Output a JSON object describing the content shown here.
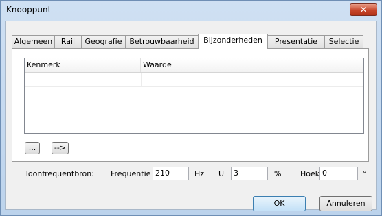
{
  "window": {
    "title": "Knooppunt",
    "close_glyph": "✕"
  },
  "tabs": [
    {
      "label": "Algemeen"
    },
    {
      "label": "Rail"
    },
    {
      "label": "Geografie"
    },
    {
      "label": "Betrouwbaarheid"
    },
    {
      "label": "Bijzonderheden",
      "active": true
    },
    {
      "label": "Presentatie"
    },
    {
      "label": "Selectie"
    }
  ],
  "grid": {
    "columns": [
      "Kenmerk",
      "Waarde"
    ],
    "rows": [
      [
        "",
        ""
      ]
    ]
  },
  "buttons": {
    "browse": "...",
    "arrow": "-->"
  },
  "source": {
    "label": "Toonfrequentbron:",
    "frequency_label": "Frequentie",
    "frequency_value": "210",
    "frequency_unit": "Hz",
    "u_label": "U",
    "u_value": "3",
    "u_unit": "%",
    "angle_label": "Hoek",
    "angle_value": "0",
    "angle_unit": "°"
  },
  "footer": {
    "ok": "OK",
    "cancel": "Annuleren"
  }
}
